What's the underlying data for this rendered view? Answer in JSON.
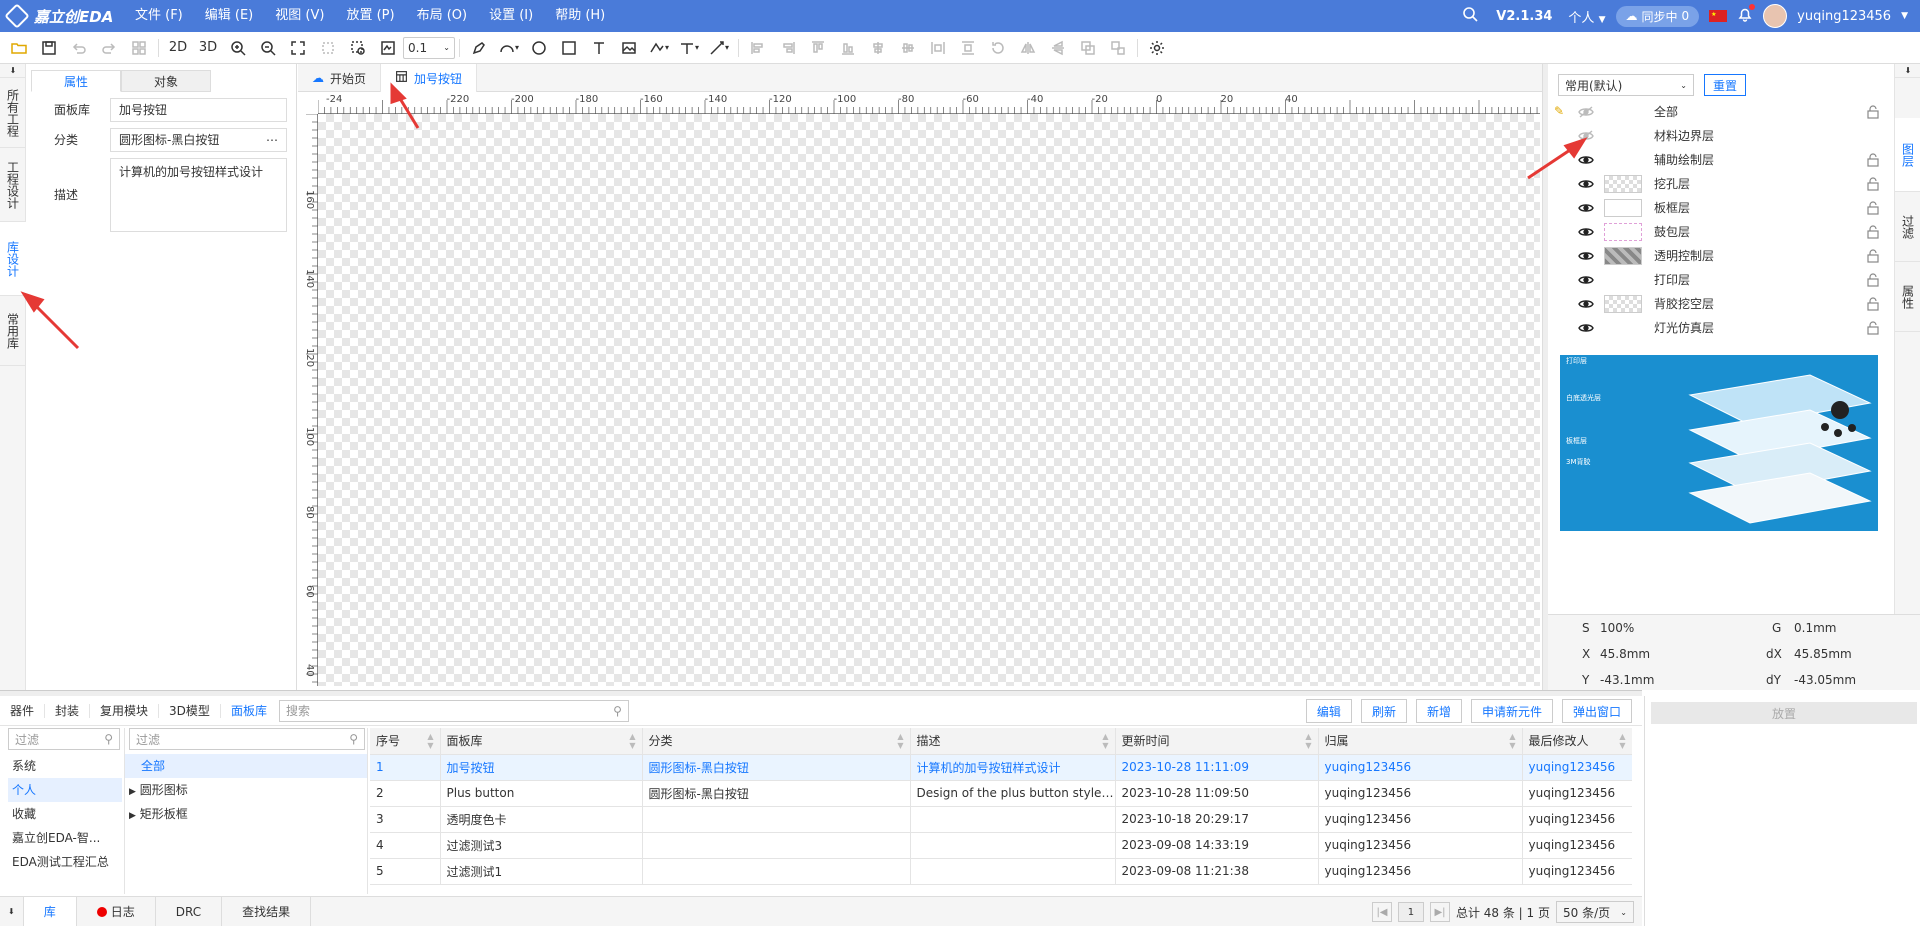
{
  "app": {
    "logo": "嘉立创EDA",
    "menu": [
      "文件 (F)",
      "编辑 (E)",
      "视图 (V)",
      "放置 (P)",
      "布局 (O)",
      "设置 (I)",
      "帮助 (H)"
    ],
    "version": "V2.1.34",
    "mode": "个人",
    "sync_label": "同步中",
    "sync_count": "0",
    "username": "yuqing123456"
  },
  "toolbar": {
    "view_2d": "2D",
    "view_3d": "3D",
    "grid_value": "0.1"
  },
  "left_tabs": [
    "所有工程",
    "工程设计",
    "库设计",
    "常用库"
  ],
  "props": {
    "tabs": [
      "属性",
      "对象"
    ],
    "fields": [
      {
        "label": "面板库",
        "value": "加号按钮"
      },
      {
        "label": "分类",
        "value": "圆形图标-黑白按钮"
      },
      {
        "label": "描述",
        "value": "计算机的加号按钮样式设计"
      }
    ]
  },
  "doc_tabs": [
    "开始页",
    "加号按钮"
  ],
  "ruler": {
    "h_labels": [
      "-24",
      "-220",
      "-200",
      "-180",
      "-160",
      "-140",
      "-120",
      "-100",
      "-80",
      "-60",
      "-40",
      "-20",
      "0",
      "20",
      "40"
    ],
    "v_labels": [
      "160",
      "140",
      "120",
      "100",
      "80",
      "60",
      "40"
    ]
  },
  "layers": {
    "preset": "常用(默认)",
    "reset_label": "重置",
    "items": [
      {
        "name": "全部",
        "color": "none"
      },
      {
        "name": "材料边界层",
        "color": "none"
      },
      {
        "name": "辅助绘制层",
        "color": "none"
      },
      {
        "name": "挖孔层",
        "color": "#e0e0e0"
      },
      {
        "name": "板框层",
        "color": "#ffffff"
      },
      {
        "name": "鼓包层",
        "color": "#ffd6f5"
      },
      {
        "name": "透明控制层",
        "color": "#9a9a9a"
      },
      {
        "name": "打印层",
        "color": "none"
      },
      {
        "name": "背胶挖空层",
        "color": "#e8e8e8"
      },
      {
        "name": "灯光仿真层",
        "color": "none"
      }
    ],
    "preview_labels": [
      "打印层",
      "白底透光层",
      "板框层",
      "3M背胶"
    ]
  },
  "right_tabs": [
    "图层",
    "过滤",
    "属性"
  ],
  "coords": {
    "s_label": "S",
    "s_value": "100%",
    "g_label": "G",
    "g_value": "0.1mm",
    "x_label": "X",
    "x_value": "45.8mm",
    "dx_label": "dX",
    "dx_value": "45.85mm",
    "y_label": "Y",
    "y_value": "-43.1mm",
    "dy_label": "dY",
    "dy_value": "-43.05mm"
  },
  "library": {
    "tabs": [
      "器件",
      "封装",
      "复用模块",
      "3D模型",
      "面板库"
    ],
    "search_placeholder": "搜索",
    "filter_placeholder": "过滤",
    "actions": [
      "编辑",
      "刷新",
      "新增",
      "申请新元件",
      "弹出窗口"
    ],
    "owners": [
      "系统",
      "个人",
      "收藏",
      "嘉立创EDA-智...",
      "EDA测试工程汇总"
    ],
    "tree": [
      "全部",
      "圆形图标",
      "矩形板框"
    ],
    "columns": [
      "序号",
      "面板库",
      "分类",
      "描述",
      "更新时间",
      "归属",
      "最后修改人"
    ],
    "rows": [
      [
        "1",
        "加号按钮",
        "圆形图标-黑白按钮",
        "计算机的加号按钮样式设计",
        "2023-10-28 11:11:09",
        "yuqing123456",
        "yuqing123456"
      ],
      [
        "2",
        "Plus button",
        "圆形图标-黑白按钮",
        "Design of the plus button style fo...",
        "2023-10-28 11:09:50",
        "yuqing123456",
        "yuqing123456"
      ],
      [
        "3",
        "透明度色卡",
        "",
        "",
        "2023-10-18 20:29:17",
        "yuqing123456",
        "yuqing123456"
      ],
      [
        "4",
        "过滤测试3",
        "",
        "",
        "2023-09-08 14:33:19",
        "yuqing123456",
        "yuqing123456"
      ],
      [
        "5",
        "过滤测试1",
        "",
        "",
        "2023-09-08 11:21:38",
        "yuqing123456",
        "yuqing123456"
      ]
    ],
    "place_label": "放置"
  },
  "status": {
    "tabs": [
      "库",
      "日志",
      "DRC",
      "查找结果"
    ],
    "page": "1",
    "summary": "总计 48 条 | 1 页",
    "page_size": "50 条/页"
  }
}
